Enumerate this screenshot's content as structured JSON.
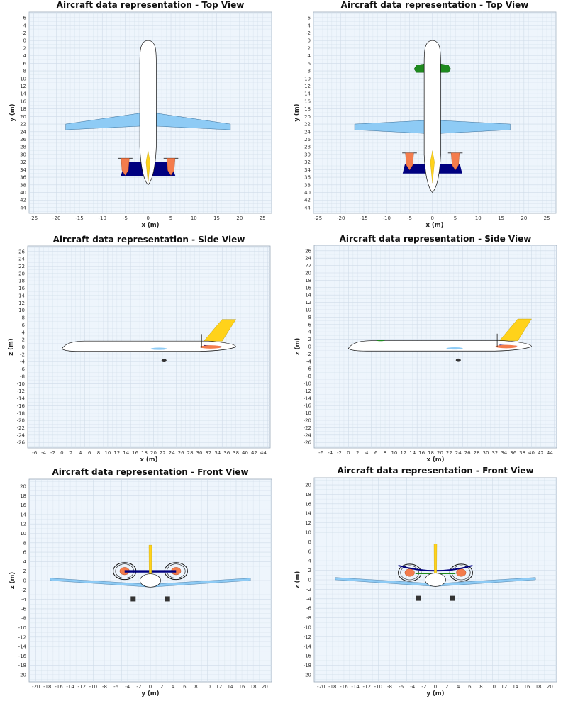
{
  "views": [
    {
      "title": "Aircraft data representation - Top View",
      "view": "top",
      "variant": "A",
      "xlabel": "x (m)",
      "ylabel": "y (m)",
      "xticks": [
        "-25",
        "-20",
        "-15",
        "-10",
        "-5",
        "0",
        "5",
        "10",
        "15",
        "20",
        "25"
      ],
      "yticks": [
        "-6",
        "-4",
        "-2",
        "0",
        "2",
        "4",
        "6",
        "8",
        "10",
        "12",
        "14",
        "16",
        "18",
        "20",
        "22",
        "24",
        "26",
        "28",
        "30",
        "32",
        "34",
        "36",
        "38",
        "40",
        "42",
        "44"
      ]
    },
    {
      "title": "Aircraft data representation - Top View",
      "view": "top",
      "variant": "B",
      "xlabel": "x (m)",
      "ylabel": "y (m)",
      "xticks": [
        "-25",
        "-20",
        "-15",
        "-10",
        "-5",
        "0",
        "5",
        "10",
        "15",
        "20",
        "25"
      ],
      "yticks": [
        "-6",
        "-4",
        "-2",
        "0",
        "2",
        "4",
        "6",
        "8",
        "10",
        "12",
        "14",
        "16",
        "18",
        "20",
        "22",
        "24",
        "26",
        "28",
        "30",
        "32",
        "34",
        "36",
        "38",
        "40",
        "42",
        "44"
      ]
    },
    {
      "title": "Aircraft data representation - Side View",
      "view": "side",
      "variant": "A",
      "xlabel": "x (m)",
      "ylabel": "z (m)",
      "xticks": [
        "-6",
        "-4",
        "-2",
        "0",
        "2",
        "4",
        "6",
        "8",
        "10",
        "12",
        "14",
        "16",
        "18",
        "20",
        "22",
        "24",
        "26",
        "28",
        "30",
        "32",
        "34",
        "36",
        "38",
        "40",
        "42",
        "44"
      ],
      "yticks": [
        "26",
        "24",
        "22",
        "20",
        "18",
        "16",
        "14",
        "12",
        "10",
        "8",
        "6",
        "4",
        "2",
        "0",
        "-2",
        "-4",
        "-6",
        "-8",
        "-10",
        "-12",
        "-14",
        "-16",
        "-18",
        "-20",
        "-22",
        "-24",
        "-26"
      ]
    },
    {
      "title": "Aircraft data representation - Side View",
      "view": "side",
      "variant": "B",
      "xlabel": "x (m)",
      "ylabel": "z (m)",
      "xticks": [
        "-6",
        "-4",
        "-2",
        "0",
        "2",
        "4",
        "6",
        "8",
        "10",
        "12",
        "14",
        "16",
        "18",
        "20",
        "22",
        "24",
        "26",
        "28",
        "30",
        "32",
        "34",
        "36",
        "38",
        "40",
        "42",
        "44"
      ],
      "yticks": [
        "26",
        "24",
        "22",
        "20",
        "18",
        "16",
        "14",
        "12",
        "10",
        "8",
        "6",
        "4",
        "2",
        "0",
        "-2",
        "-4",
        "-6",
        "-8",
        "-10",
        "-12",
        "-14",
        "-16",
        "-18",
        "-20",
        "-22",
        "-24",
        "-26"
      ]
    },
    {
      "title": "Aircraft data representation - Front View",
      "view": "front",
      "variant": "A",
      "xlabel": "y (m)",
      "ylabel": "z (m)",
      "xticks": [
        "-20",
        "-18",
        "-16",
        "-14",
        "-12",
        "-10",
        "-8",
        "-6",
        "-4",
        "-2",
        "0",
        "2",
        "4",
        "6",
        "8",
        "10",
        "12",
        "14",
        "16",
        "18",
        "20"
      ],
      "yticks": [
        "20",
        "18",
        "16",
        "14",
        "12",
        "10",
        "8",
        "6",
        "4",
        "2",
        "0",
        "-2",
        "-4",
        "-6",
        "-8",
        "-10",
        "-12",
        "-14",
        "-16",
        "-18",
        "-20"
      ]
    },
    {
      "title": "Aircraft data representation - Front View",
      "view": "front",
      "variant": "B",
      "xlabel": "y (m)",
      "ylabel": "z (m)",
      "xticks": [
        "-20",
        "-18",
        "-16",
        "-14",
        "-12",
        "-10",
        "-8",
        "-6",
        "-4",
        "-2",
        "0",
        "2",
        "4",
        "6",
        "8",
        "10",
        "12",
        "14",
        "16",
        "18",
        "20"
      ],
      "yticks": [
        "20",
        "18",
        "16",
        "14",
        "12",
        "10",
        "8",
        "6",
        "4",
        "2",
        "0",
        "-2",
        "-4",
        "-6",
        "-8",
        "-10",
        "-12",
        "-14",
        "-16",
        "-18",
        "-20"
      ]
    }
  ],
  "colors": {
    "plot_bg": "#eef5fc",
    "grid": "#cfdbe8",
    "fuselage": "#ffffff",
    "wing": "#8ecbf5",
    "htail": "#000080",
    "vtail": "#ffd21a",
    "engine": "#f47c4c",
    "canard": "#1e8a1e",
    "gear": "#333333"
  }
}
